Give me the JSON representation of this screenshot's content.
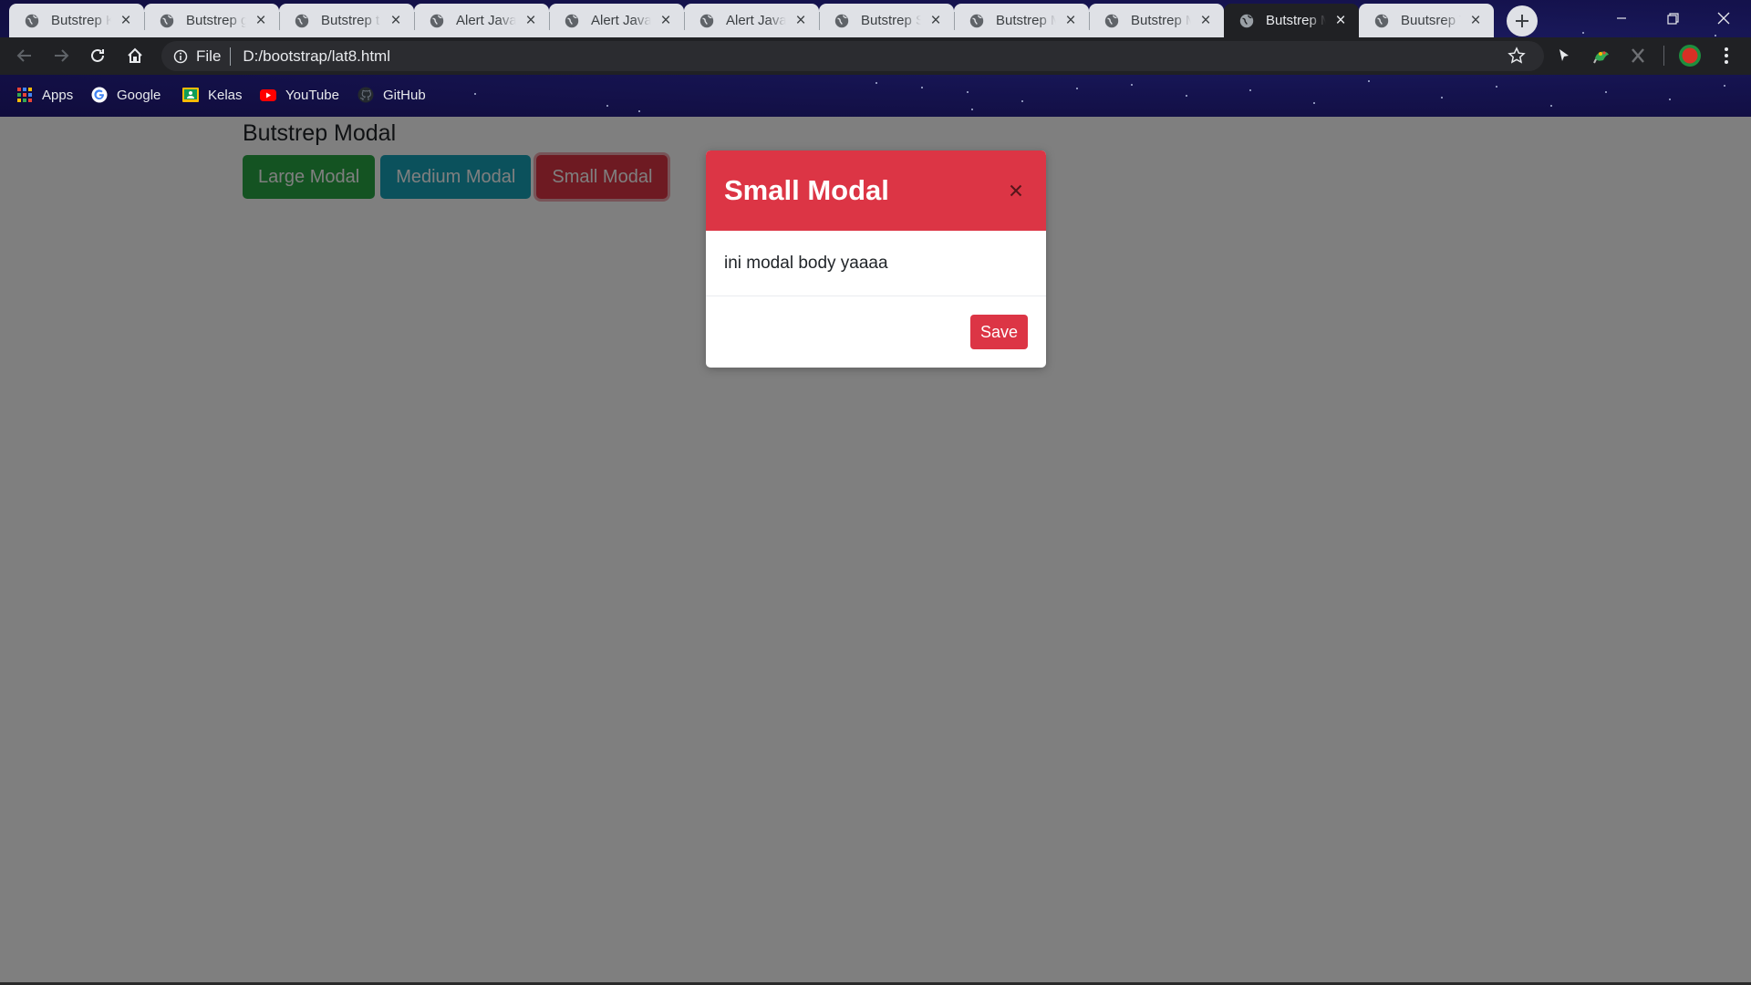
{
  "browser": {
    "tabs": [
      {
        "title": "Butstrep K",
        "active": false
      },
      {
        "title": "Butstrep g",
        "active": false
      },
      {
        "title": "Butstrep t",
        "active": false
      },
      {
        "title": "Alert Javas",
        "active": false
      },
      {
        "title": "Alert Javas",
        "active": false
      },
      {
        "title": "Alert Javas",
        "active": false
      },
      {
        "title": "Butstrep S",
        "active": false
      },
      {
        "title": "Butstrep M",
        "active": false
      },
      {
        "title": "Butstrep M",
        "active": false
      },
      {
        "title": "Butstrep M",
        "active": true
      },
      {
        "title": "Buutsrep T",
        "active": false
      }
    ],
    "address": {
      "scheme_label": "File",
      "url": "D:/bootstrap/lat8.html"
    },
    "bookmarks": [
      {
        "label": "Apps",
        "icon": "apps-grid-icon"
      },
      {
        "label": "Google",
        "icon": "google-icon"
      },
      {
        "label": "Kelas",
        "icon": "classroom-icon"
      },
      {
        "label": "YouTube",
        "icon": "youtube-icon"
      },
      {
        "label": "GitHub",
        "icon": "github-icon"
      }
    ]
  },
  "page": {
    "heading": "Butstrep Modal",
    "buttons": [
      {
        "label": "Large Modal",
        "color": "#28a745"
      },
      {
        "label": "Medium Modal",
        "color": "#17a2b8"
      },
      {
        "label": "Small Modal",
        "color": "#dc3545"
      }
    ]
  },
  "modal": {
    "title": "Small Modal",
    "body": "ini modal body yaaaa",
    "save_label": "Save",
    "accent": "#dc3545"
  }
}
